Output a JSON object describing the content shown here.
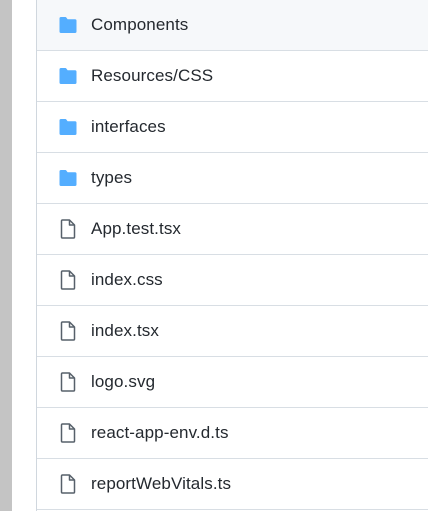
{
  "files": [
    {
      "name": "Components",
      "type": "folder",
      "icon": "folder-icon"
    },
    {
      "name": "Resources/CSS",
      "type": "folder",
      "icon": "folder-icon"
    },
    {
      "name": "interfaces",
      "type": "folder",
      "icon": "folder-icon"
    },
    {
      "name": "types",
      "type": "folder",
      "icon": "folder-icon"
    },
    {
      "name": "App.test.tsx",
      "type": "file",
      "icon": "file-icon"
    },
    {
      "name": "index.css",
      "type": "file",
      "icon": "file-icon"
    },
    {
      "name": "index.tsx",
      "type": "file",
      "icon": "file-icon"
    },
    {
      "name": "logo.svg",
      "type": "file",
      "icon": "file-icon"
    },
    {
      "name": "react-app-env.d.ts",
      "type": "file",
      "icon": "file-icon"
    },
    {
      "name": "reportWebVitals.ts",
      "type": "file",
      "icon": "file-icon"
    }
  ],
  "colors": {
    "folder": "#54aeff",
    "file_icon": "#57606a",
    "text": "#24292f",
    "divider": "#d8dee4",
    "gutter": "#c4c4c4"
  }
}
